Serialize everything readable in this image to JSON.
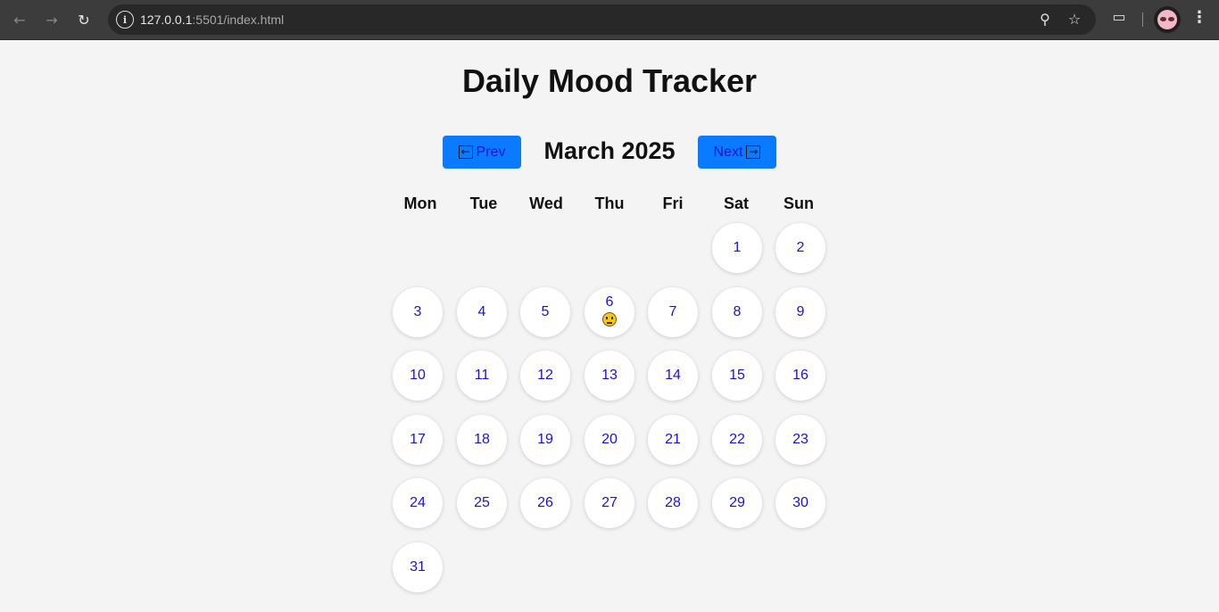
{
  "browser": {
    "url_host": "127.0.0.1",
    "url_rest": ":5501/index.html"
  },
  "page": {
    "title": "Daily Mood Tracker"
  },
  "calendar": {
    "month_label": "March 2025",
    "prev_label": "Prev",
    "next_label": "Next",
    "weekdays": [
      "Mon",
      "Tue",
      "Wed",
      "Thu",
      "Fri",
      "Sat",
      "Sun"
    ],
    "days": [
      "1",
      "2",
      "3",
      "4",
      "5",
      "6",
      "7",
      "8",
      "9",
      "10",
      "11",
      "12",
      "13",
      "14",
      "15",
      "16",
      "17",
      "18",
      "19",
      "20",
      "21",
      "22",
      "23",
      "24",
      "25",
      "26",
      "27",
      "28",
      "29",
      "30",
      "31"
    ],
    "moods": {
      "6": "neutral-face"
    }
  },
  "colors": {
    "button_bg": "#0a7bff",
    "button_text": "#1a12d8",
    "day_text": "#1a12d8",
    "page_bg": "#f4f4f4"
  }
}
